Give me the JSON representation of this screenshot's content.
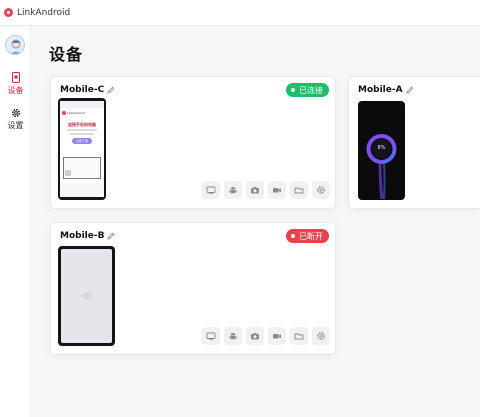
{
  "app": {
    "title": "LinkAndroid"
  },
  "sidebar": {
    "items": [
      {
        "label": "设备",
        "active": true,
        "icon": "device-icon"
      },
      {
        "label": "设置",
        "active": false,
        "icon": "gear-icon"
      }
    ]
  },
  "page": {
    "title": "设备"
  },
  "devices": [
    {
      "name": "Mobile-C",
      "status": "已连接",
      "status_color": "#1fbd6b",
      "screen": {
        "app_name": "LinkAndroid",
        "headline": "连接手机和电脑",
        "button_label": "立即下载"
      }
    },
    {
      "name": "Mobile-A",
      "screen": {
        "clock_text": "8%"
      }
    },
    {
      "name": "Mobile-B",
      "status": "已断开",
      "status_color": "#ee3f4d"
    }
  ],
  "toolbar_icons": [
    "screen-mirror-icon",
    "android-icon",
    "camera-icon",
    "video-record-icon",
    "folder-icon",
    "settings-icon"
  ],
  "colors": {
    "accent": "#e0253e",
    "connected": "#1fbd6b",
    "disconnected": "#ee3f4d"
  }
}
